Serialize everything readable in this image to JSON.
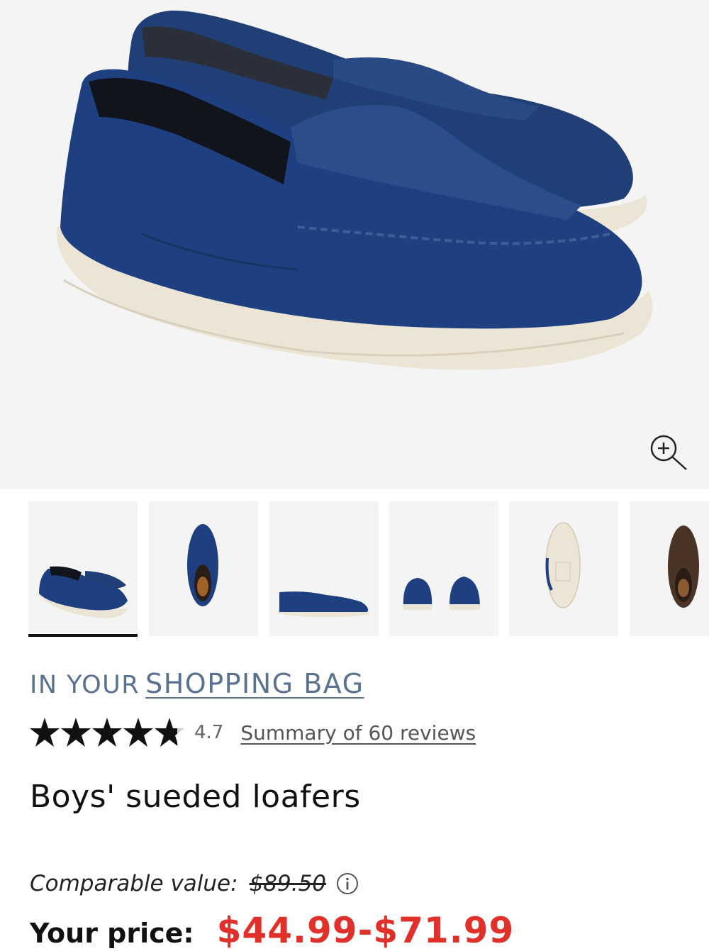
{
  "hero": {
    "image": "navy-sueded-loafers-pair",
    "zoom_icon": "zoom-in-icon"
  },
  "thumbnails": [
    {
      "view": "pair-angle",
      "color": "#1e3f78"
    },
    {
      "view": "top",
      "color": "#1e3f78"
    },
    {
      "view": "side",
      "color": "#1e3f78"
    },
    {
      "view": "heels",
      "color": "#1e3f78"
    },
    {
      "view": "sole",
      "color": "#ece5d6"
    },
    {
      "view": "brown-top",
      "color": "#4a3426"
    }
  ],
  "bag": {
    "prefix": "IN YOUR",
    "link": "SHOPPING BAG"
  },
  "rating": {
    "value": "4.7",
    "reviews_link": "Summary of 60 reviews"
  },
  "product": {
    "title": "Boys' sueded loafers"
  },
  "price": {
    "comparable_label": "Comparable value:",
    "comparable_value": "$89.50",
    "your_price_label": "Your price:",
    "your_price_value": "$44.99-$71.99"
  },
  "colors": {
    "accent_price": "#e0302a",
    "link_blue": "#5a7290",
    "shoe_navy": "#1e3f78",
    "sole_cream": "#ece5d6"
  }
}
